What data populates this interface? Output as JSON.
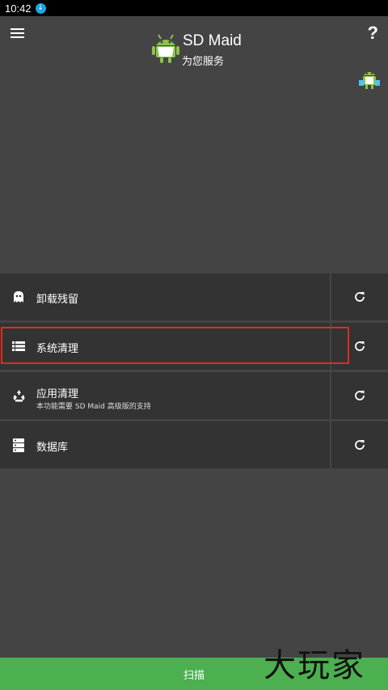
{
  "status_bar": {
    "time": "10:42"
  },
  "header": {
    "app_name": "SD Maid",
    "tagline": "为您服务",
    "help_glyph": "?"
  },
  "tools": [
    {
      "label": "卸载残留",
      "subtitle": "",
      "icon": "ghost-icon"
    },
    {
      "label": "系统清理",
      "subtitle": "",
      "icon": "list-icon"
    },
    {
      "label": "应用清理",
      "subtitle": "本功能需要 SD Maid 高级版的支持",
      "icon": "recycle-icon"
    },
    {
      "label": "数据库",
      "subtitle": "",
      "icon": "database-icon"
    }
  ],
  "scan_button": {
    "label": "扫描"
  },
  "watermark": "大玩家",
  "colors": {
    "background": "#444444",
    "row": "#333333",
    "scan": "#4caf50",
    "highlight": "#d92f1f",
    "logo": "#8bc34a"
  }
}
